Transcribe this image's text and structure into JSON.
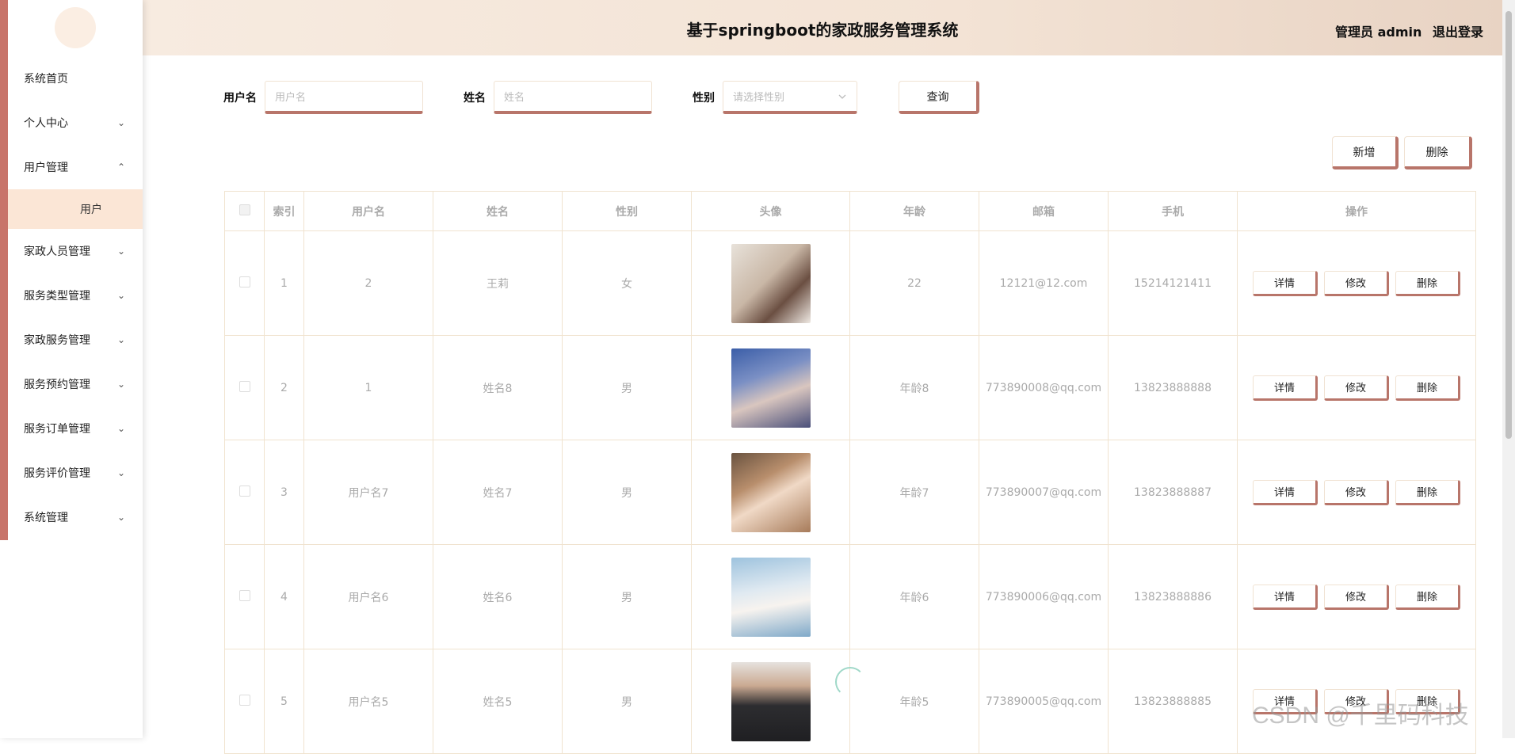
{
  "header": {
    "title": "基于springboot的家政服务管理系统",
    "user_label": "管理员 admin",
    "logout": "退出登录"
  },
  "sidebar": {
    "items": [
      {
        "label": "系统首页",
        "expand": ""
      },
      {
        "label": "个人中心",
        "expand": "⌄"
      },
      {
        "label": "用户管理",
        "expand": "⌃"
      },
      {
        "label": "家政人员管理",
        "expand": "⌄"
      },
      {
        "label": "服务类型管理",
        "expand": "⌄"
      },
      {
        "label": "家政服务管理",
        "expand": "⌄"
      },
      {
        "label": "服务预约管理",
        "expand": "⌄"
      },
      {
        "label": "服务订单管理",
        "expand": "⌄"
      },
      {
        "label": "服务评价管理",
        "expand": "⌄"
      },
      {
        "label": "系统管理",
        "expand": "⌄"
      }
    ],
    "sub_item": "用户"
  },
  "search": {
    "username_label": "用户名",
    "username_placeholder": "用户名",
    "name_label": "姓名",
    "name_placeholder": "姓名",
    "gender_label": "性别",
    "gender_placeholder": "请选择性别",
    "query_button": "查询"
  },
  "actions": {
    "add": "新增",
    "delete": "删除"
  },
  "table": {
    "headers": [
      "索引",
      "用户名",
      "姓名",
      "性别",
      "头像",
      "年龄",
      "邮箱",
      "手机",
      "操作"
    ],
    "rows": [
      {
        "index": "1",
        "username": "2",
        "name": "王莉",
        "gender": "女",
        "age": "22",
        "email": "12121@12.com",
        "phone": "15214121411"
      },
      {
        "index": "2",
        "username": "1",
        "name": "姓名8",
        "gender": "男",
        "age": "年龄8",
        "email": "773890008@qq.com",
        "phone": "13823888888"
      },
      {
        "index": "3",
        "username": "用户名7",
        "name": "姓名7",
        "gender": "男",
        "age": "年龄7",
        "email": "773890007@qq.com",
        "phone": "13823888887"
      },
      {
        "index": "4",
        "username": "用户名6",
        "name": "姓名6",
        "gender": "男",
        "age": "年龄6",
        "email": "773890006@qq.com",
        "phone": "13823888886"
      },
      {
        "index": "5",
        "username": "用户名5",
        "name": "姓名5",
        "gender": "男",
        "age": "年龄5",
        "email": "773890005@qq.com",
        "phone": "13823888885"
      }
    ],
    "row_actions": {
      "detail": "详情",
      "edit": "修改",
      "delete": "删除"
    }
  },
  "watermark": "CSDN @千里码科技",
  "colors": {
    "accent": "#c8746a",
    "header_bg": "#f3e3d5",
    "submenu_bg": "#fbe6d6",
    "border": "#f0e3cf"
  }
}
